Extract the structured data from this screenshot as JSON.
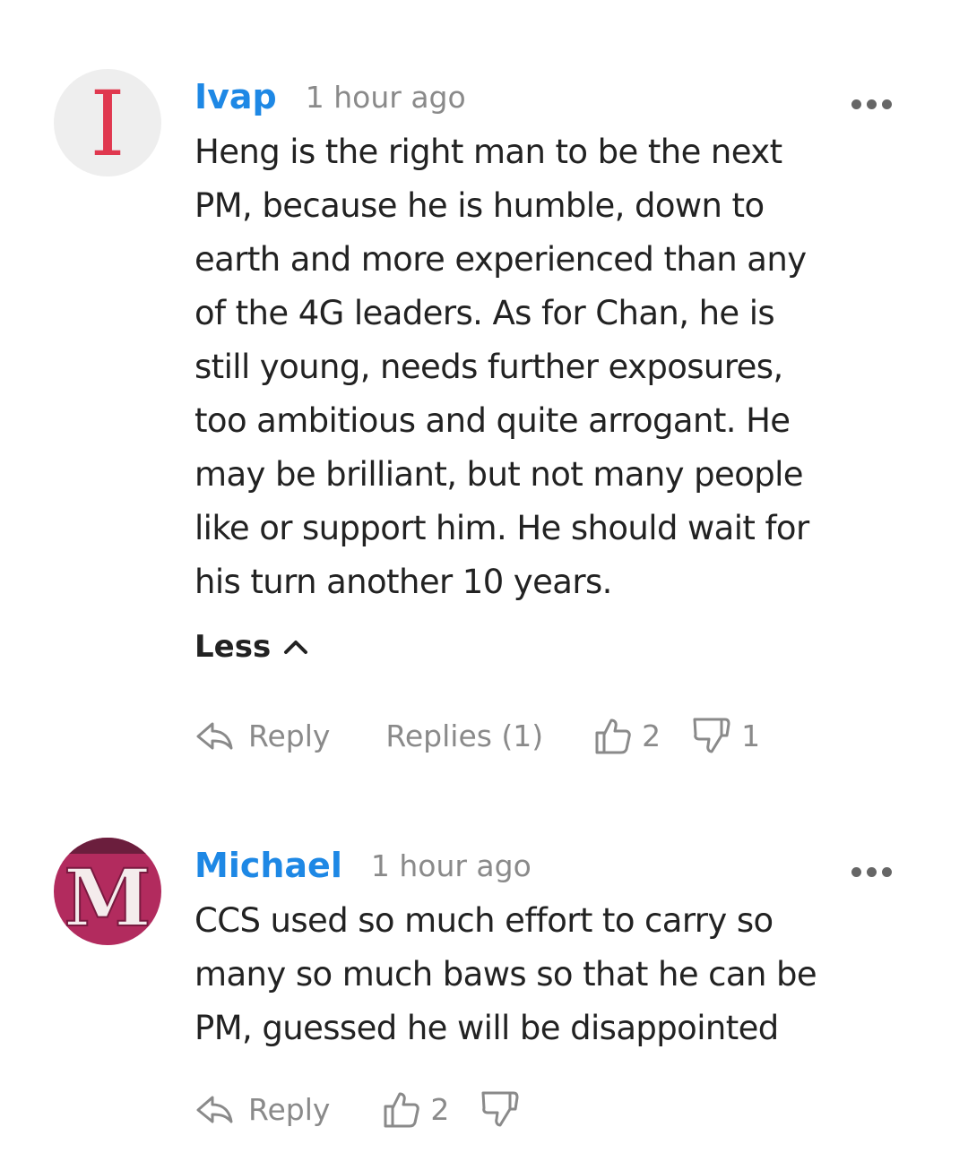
{
  "comments": [
    {
      "author": "Ivap",
      "avatar_letter": "I",
      "time": "1 hour ago",
      "body_lines": [
        "Heng is the right man to be the next",
        "PM, because he is humble, down to",
        "earth and more experienced than any",
        "of the 4G leaders. As for Chan, he is",
        "still young, needs further exposures,",
        "too ambitious and quite arrogant. He",
        "may be brilliant, but not many people",
        "like or support him. He should wait for",
        "his turn another 10 years."
      ],
      "less_label": "Less",
      "reply_label": "Reply",
      "replies_label": "Replies (1)",
      "likes": "2",
      "dislikes": "1"
    },
    {
      "author": "Michael",
      "avatar_letter": "M",
      "time": "1 hour ago",
      "body_lines": [
        "CCS used so much effort to carry so",
        "many so much baws so that he can be",
        "PM, guessed he will be disappointed"
      ],
      "reply_label": "Reply",
      "likes": "2"
    }
  ],
  "icons": {
    "reply": "reply-arrow-icon",
    "like": "thumbs-up-icon",
    "dislike": "thumbs-down-icon",
    "more": "more-dots-icon",
    "collapse": "chevron-up-icon"
  },
  "colors": {
    "author": "#1e88e5",
    "muted": "#8a8a8a",
    "text": "#222222",
    "avatar1_bg": "#eeeeee",
    "avatar1_letter": "#e0384f",
    "avatar2_bg": "#b22b5e"
  }
}
